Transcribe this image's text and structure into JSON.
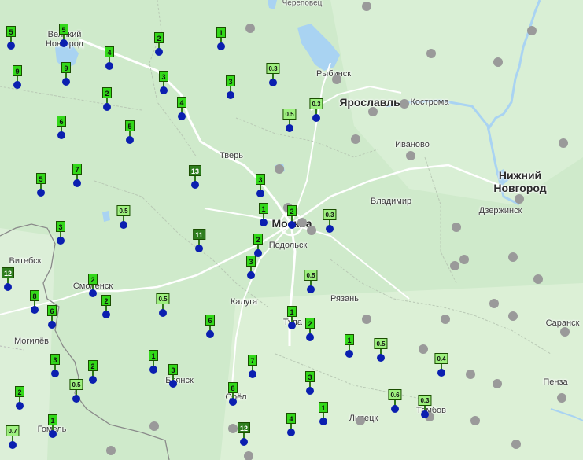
{
  "colors": {
    "background": "#cfeacb",
    "water": "#a9d3f2",
    "road": "#ffffff",
    "border": "#8a8a8a",
    "marker_badge": "#33d81a",
    "marker_badge_high": "#2e7d1e",
    "marker_dot": "#0b1fb0",
    "station_dot": "#9a9a9a"
  },
  "cities": [
    {
      "name": "Череповец",
      "size": "small"
    },
    {
      "name": "Великий",
      "size": "mid"
    },
    {
      "name": "Новгород",
      "size": "mid"
    },
    {
      "name": "Рыбинск",
      "size": "mid"
    },
    {
      "name": "Ярославль",
      "size": "major"
    },
    {
      "name": "Кострома",
      "size": "mid"
    },
    {
      "name": "Иваново",
      "size": "mid"
    },
    {
      "name": "Тверь",
      "size": "mid"
    },
    {
      "name": "Нижний",
      "size": "major"
    },
    {
      "name": "Новгород",
      "size": "major"
    },
    {
      "name": "Владимир",
      "size": "mid"
    },
    {
      "name": "Дзержинск",
      "size": "mid"
    },
    {
      "name": "Москва",
      "size": "major"
    },
    {
      "name": "Подольск",
      "size": "mid"
    },
    {
      "name": "Витебск",
      "size": "mid"
    },
    {
      "name": "Смоленск",
      "size": "mid"
    },
    {
      "name": "Калуга",
      "size": "mid"
    },
    {
      "name": "Рязань",
      "size": "mid"
    },
    {
      "name": "Могилёв",
      "size": "mid"
    },
    {
      "name": "Тула",
      "size": "mid"
    },
    {
      "name": "Саранск",
      "size": "mid"
    },
    {
      "name": "Брянск",
      "size": "mid"
    },
    {
      "name": "Орёл",
      "size": "mid"
    },
    {
      "name": "Пенза",
      "size": "mid"
    },
    {
      "name": "Гомель",
      "size": "mid"
    },
    {
      "name": "Липецк",
      "size": "mid"
    },
    {
      "name": "Тамбов",
      "size": "mid"
    }
  ],
  "markers": [
    {
      "label": "5",
      "level": "low"
    },
    {
      "label": "5",
      "level": "low"
    },
    {
      "label": "9",
      "level": "low"
    },
    {
      "label": "2",
      "level": "low"
    },
    {
      "label": "1",
      "level": "low"
    },
    {
      "label": "4",
      "level": "low"
    },
    {
      "label": "9",
      "level": "low"
    },
    {
      "label": "3",
      "level": "low"
    },
    {
      "label": "0.3",
      "level": "small"
    },
    {
      "label": "3",
      "level": "low"
    },
    {
      "label": "2",
      "level": "low"
    },
    {
      "label": "4",
      "level": "low"
    },
    {
      "label": "0.5",
      "level": "small"
    },
    {
      "label": "0.3",
      "level": "small"
    },
    {
      "label": "6",
      "level": "low"
    },
    {
      "label": "5",
      "level": "low"
    },
    {
      "label": "7",
      "level": "low"
    },
    {
      "label": "13",
      "level": "high"
    },
    {
      "label": "5",
      "level": "low"
    },
    {
      "label": "3",
      "level": "low"
    },
    {
      "label": "0.5",
      "level": "small"
    },
    {
      "label": "1",
      "level": "low"
    },
    {
      "label": "2",
      "level": "low"
    },
    {
      "label": "0.3",
      "level": "small"
    },
    {
      "label": "3",
      "level": "low"
    },
    {
      "label": "11",
      "level": "high"
    },
    {
      "label": "2",
      "level": "low"
    },
    {
      "label": "12",
      "level": "high"
    },
    {
      "label": "3",
      "level": "low"
    },
    {
      "label": "0.5",
      "level": "small"
    },
    {
      "label": "2",
      "level": "low"
    },
    {
      "label": "8",
      "level": "low"
    },
    {
      "label": "2",
      "level": "low"
    },
    {
      "label": "0.5",
      "level": "small"
    },
    {
      "label": "6",
      "level": "low"
    },
    {
      "label": "6",
      "level": "low"
    },
    {
      "label": "1",
      "level": "low"
    },
    {
      "label": "2",
      "level": "low"
    },
    {
      "label": "1",
      "level": "low"
    },
    {
      "label": "0.5",
      "level": "small"
    },
    {
      "label": "3",
      "level": "low"
    },
    {
      "label": "2",
      "level": "low"
    },
    {
      "label": "1",
      "level": "low"
    },
    {
      "label": "3",
      "level": "low"
    },
    {
      "label": "7",
      "level": "low"
    },
    {
      "label": "0.4",
      "level": "small"
    },
    {
      "label": "0.5",
      "level": "small"
    },
    {
      "label": "8",
      "level": "low"
    },
    {
      "label": "3",
      "level": "low"
    },
    {
      "label": "2",
      "level": "low"
    },
    {
      "label": "0.6",
      "level": "small"
    },
    {
      "label": "0.3",
      "level": "small"
    },
    {
      "label": "1",
      "level": "low"
    },
    {
      "label": "0.7",
      "level": "small"
    },
    {
      "label": "1",
      "level": "low"
    },
    {
      "label": "12",
      "level": "high"
    },
    {
      "label": "4",
      "level": "low"
    }
  ],
  "station_dot_count": 38
}
